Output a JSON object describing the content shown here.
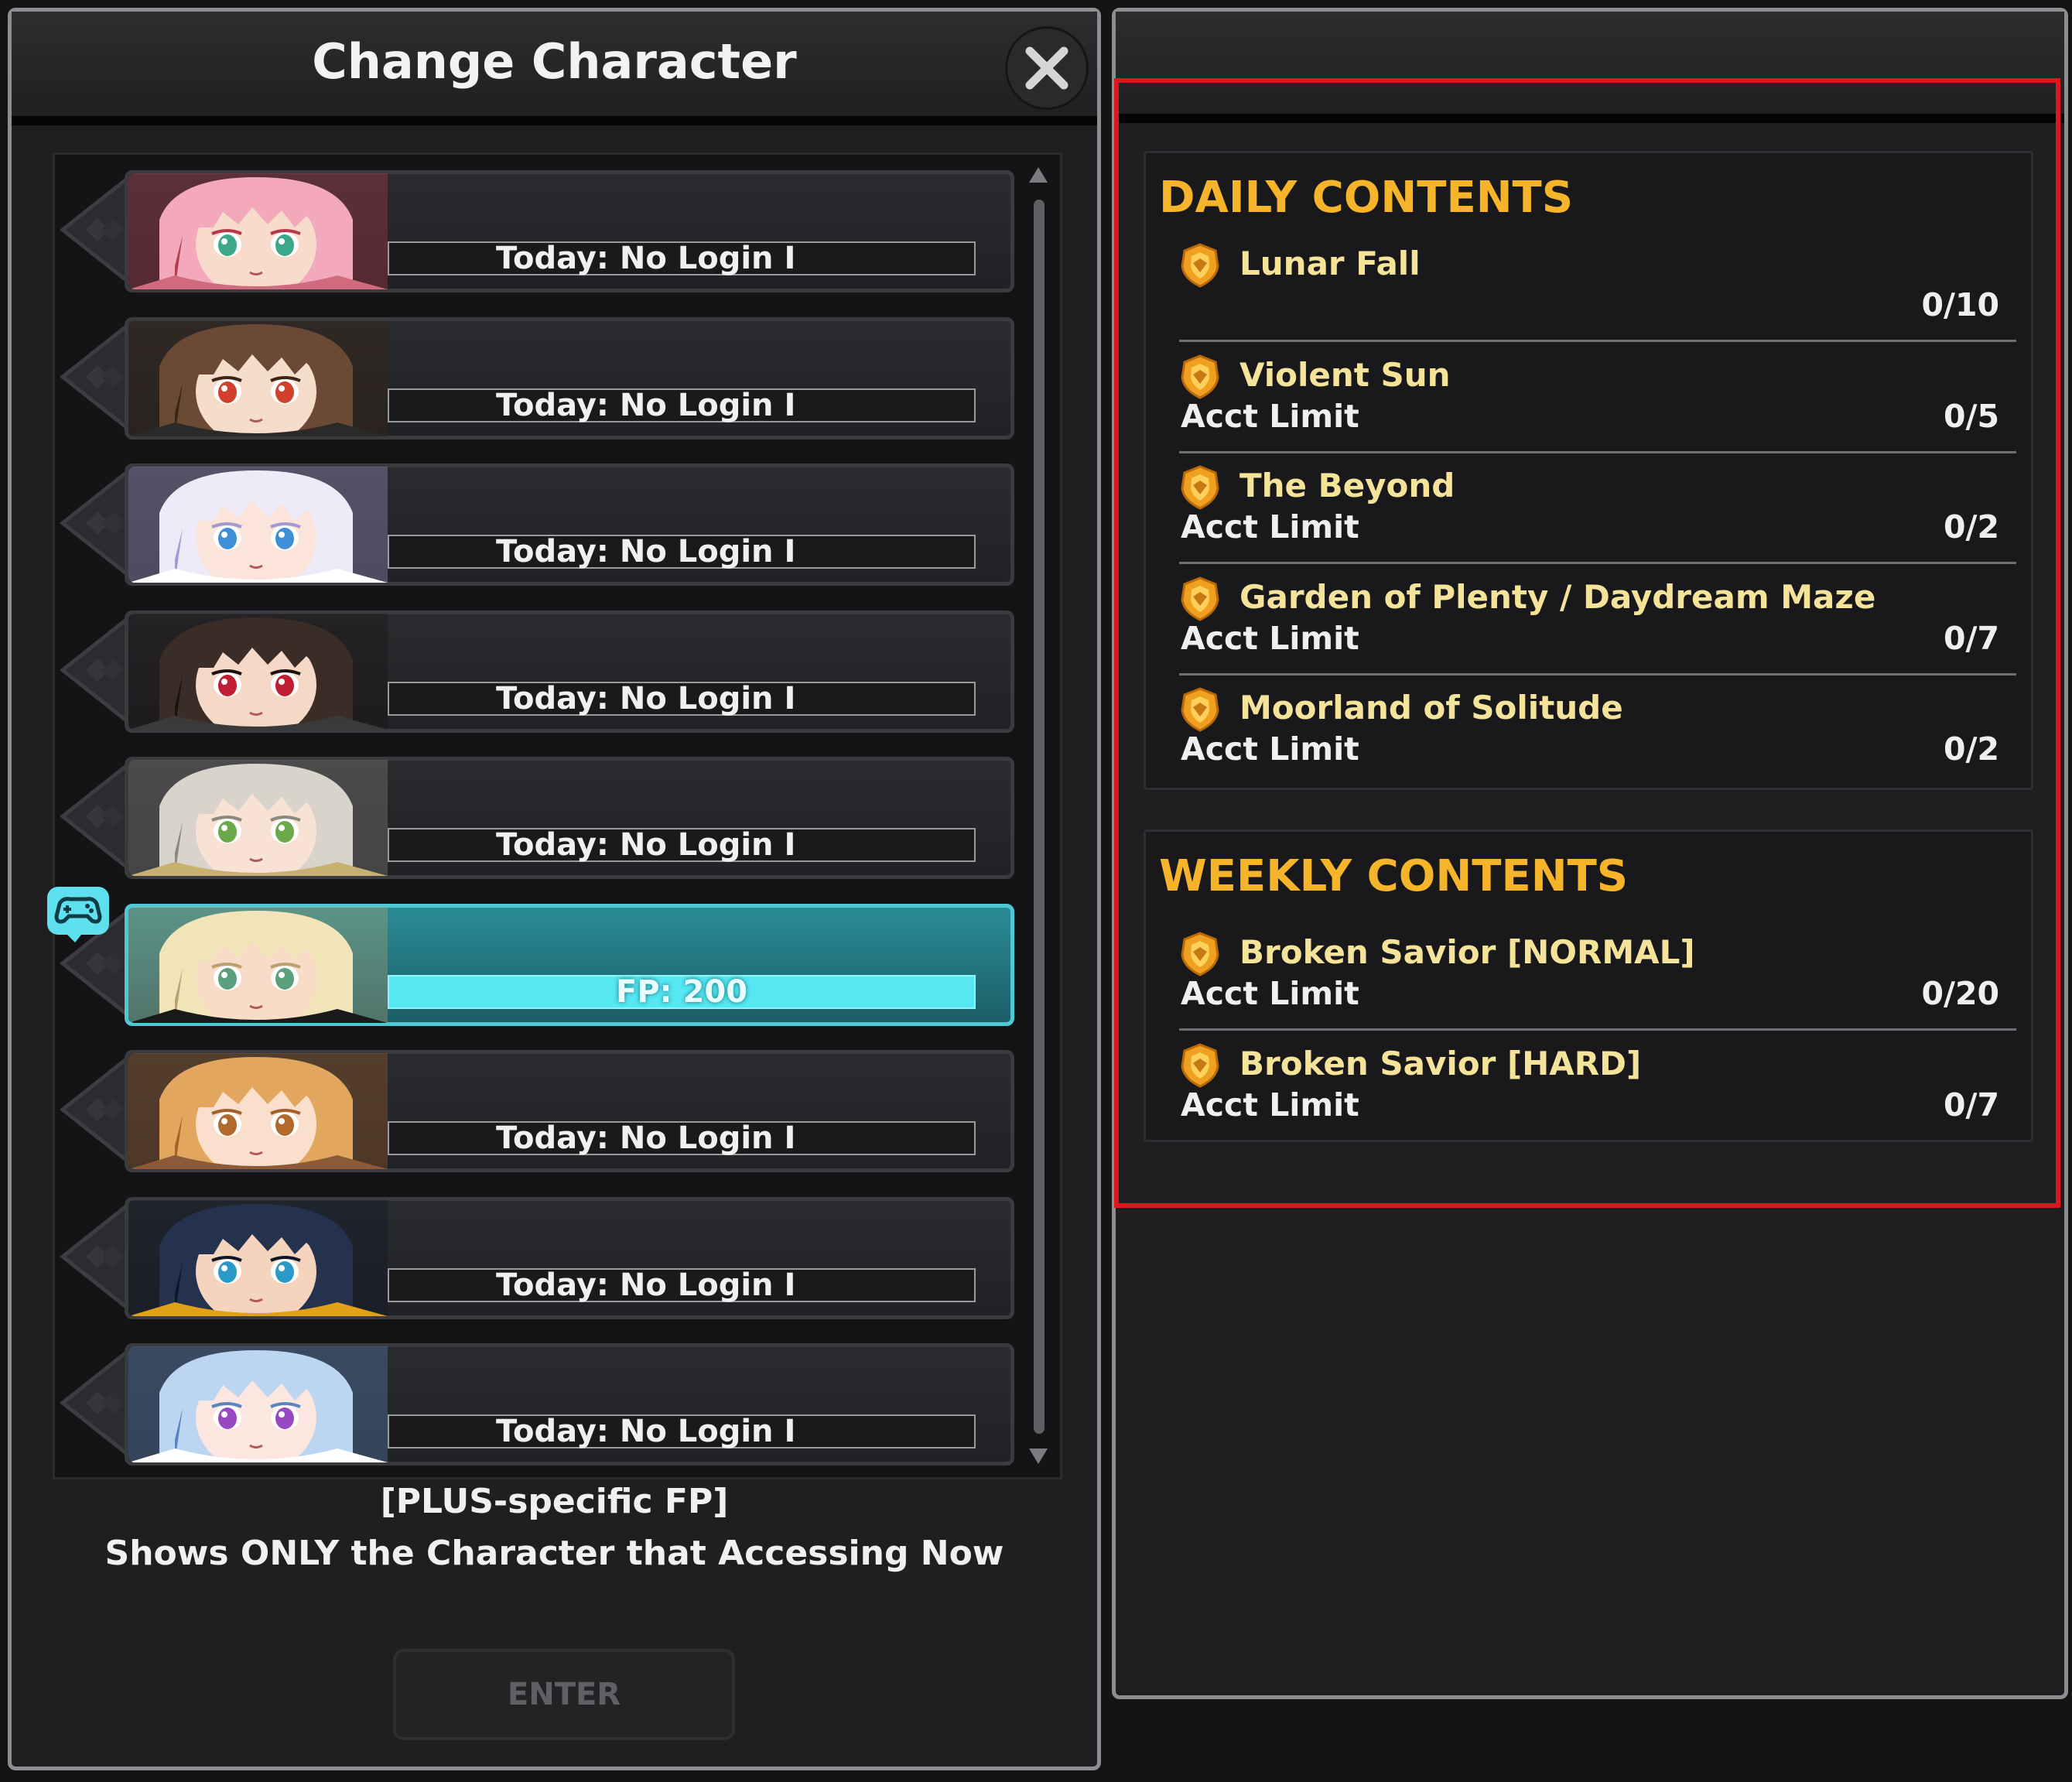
{
  "left_panel": {
    "title": "Change Character",
    "characters": [
      {
        "status": "Today: No Login I",
        "selected": false,
        "palette": {
          "hair": "#f3a9bb",
          "hair_dark": "#b73a4c",
          "skin": "#f8dccb",
          "eyes": "#3ca88a",
          "outfit": "#d06b7d"
        }
      },
      {
        "status": "Today: No Login I",
        "selected": false,
        "palette": {
          "hair": "#6a4a34",
          "hair_dark": "#3a2518",
          "skin": "#f6dccb",
          "eyes": "#d0402c",
          "outfit": "#2a2a2a"
        }
      },
      {
        "status": "Today: No Login I",
        "selected": false,
        "palette": {
          "hair": "#eeeaf8",
          "hair_dark": "#a29ad0",
          "skin": "#fbe4da",
          "eyes": "#3f8fd8",
          "outfit": "#ffffff"
        }
      },
      {
        "status": "Today: No Login I",
        "selected": false,
        "palette": {
          "hair": "#3a2c26",
          "hair_dark": "#1a1210",
          "skin": "#f6d8c6",
          "eyes": "#c01e32",
          "outfit": "#3a3a3a"
        }
      },
      {
        "status": "Today: No Login I",
        "selected": false,
        "palette": {
          "hair": "#d8d4cc",
          "hair_dark": "#8c8880",
          "skin": "#f8e2d4",
          "eyes": "#6aa84a",
          "outfit": "#c8b070"
        }
      },
      {
        "status": "FP: 200",
        "selected": true,
        "palette": {
          "hair": "#f0e4b8",
          "hair_dark": "#b8a070",
          "skin": "#f8dcc8",
          "eyes": "#5aa07c",
          "outfit": "#1a1a1a"
        }
      },
      {
        "status": "Today: No Login I",
        "selected": false,
        "palette": {
          "hair": "#e2a65e",
          "hair_dark": "#a0622a",
          "skin": "#fae0cc",
          "eyes": "#b26a2c",
          "outfit": "#8a5a3a"
        }
      },
      {
        "status": "Today: No Login I",
        "selected": false,
        "palette": {
          "hair": "#24324e",
          "hair_dark": "#0e1628",
          "skin": "#f4d4bc",
          "eyes": "#2c9ac8",
          "outfit": "#e0a018"
        }
      },
      {
        "status": "Today: No Login I",
        "selected": false,
        "palette": {
          "hair": "#bcd6f2",
          "hair_dark": "#5a86c0",
          "skin": "#fbe6e0",
          "eyes": "#9848c0",
          "outfit": "#ffffff"
        }
      }
    ],
    "note_line1": "[PLUS-specific FP]",
    "note_line2": "Shows ONLY the Character that Accessing Now",
    "enter_label": "ENTER"
  },
  "right_panel": {
    "daily": {
      "title": "DAILY CONTENTS",
      "entries": [
        {
          "name": "Lunar Fall",
          "limit": "",
          "count": "0/10"
        },
        {
          "name": "Violent Sun",
          "limit": "Acct Limit",
          "count": "0/5"
        },
        {
          "name": "The Beyond",
          "limit": "Acct Limit",
          "count": "0/2"
        },
        {
          "name": "Garden of Plenty / Daydream Maze",
          "limit": "Acct Limit",
          "count": "0/7"
        },
        {
          "name": "Moorland of Solitude",
          "limit": "Acct Limit",
          "count": "0/2"
        }
      ]
    },
    "weekly": {
      "title": "WEEKLY CONTENTS",
      "entries": [
        {
          "name": "Broken Savior [NORMAL]",
          "limit": "Acct Limit",
          "count": "0/20"
        },
        {
          "name": "Broken Savior [HARD]",
          "limit": "Acct Limit",
          "count": "0/7"
        }
      ]
    }
  },
  "colors": {
    "section_title": "#f6b42a",
    "entry_name": "#f5e39a",
    "highlight_box": "#e0141c",
    "selected_bar": "#55e7f2"
  },
  "icons": {
    "close": "close-icon",
    "medal": "medal-icon",
    "controller": "gamepad-icon",
    "scroll_up": "arrow-up-icon",
    "scroll_down": "arrow-down-icon"
  }
}
